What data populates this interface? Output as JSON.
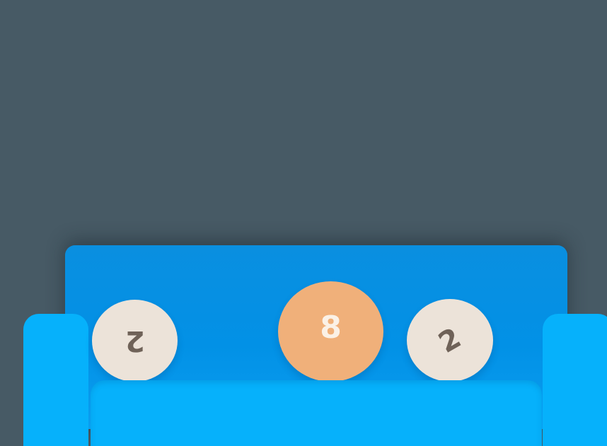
{
  "scene": {
    "background_color": "#475a65",
    "sofa": {
      "back_color": "#0291e6",
      "seat_color": "#06b1fb",
      "arm_color": "#06b1fb"
    },
    "cushions": [
      {
        "label": "2",
        "color": "#ece3d9",
        "text_color": "#6f6258",
        "orientation": "upside-down"
      },
      {
        "label": "8",
        "color": "#f0b07a",
        "text_color": "#fbf1e6",
        "orientation": "upright"
      },
      {
        "label": "2",
        "color": "#ece3d9",
        "text_color": "#6f6258",
        "orientation": "tilted"
      }
    ]
  }
}
